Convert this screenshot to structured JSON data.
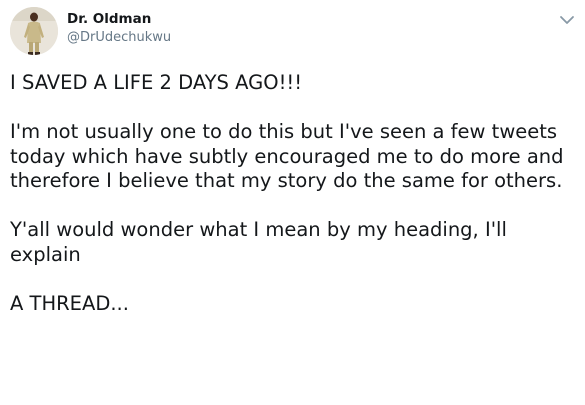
{
  "author": {
    "display_name": "Dr. Oldman",
    "handle": "@DrUdechukwu",
    "avatar_icon": "profile-photo"
  },
  "menu": {
    "icon": "chevron-down-icon"
  },
  "tweet": {
    "paragraphs": [
      "I SAVED A LIFE 2 DAYS AGO!!!",
      "I'm not usually one to do this but I've seen a few tweets today which have subtly encouraged me to do more and therefore I believe that my story do the same for others.",
      "Y'all would wonder what I mean by my heading, I'll explain",
      "A THREAD..."
    ]
  },
  "colors": {
    "text": "#14171a",
    "secondary_text": "#657786",
    "background": "#ffffff"
  }
}
